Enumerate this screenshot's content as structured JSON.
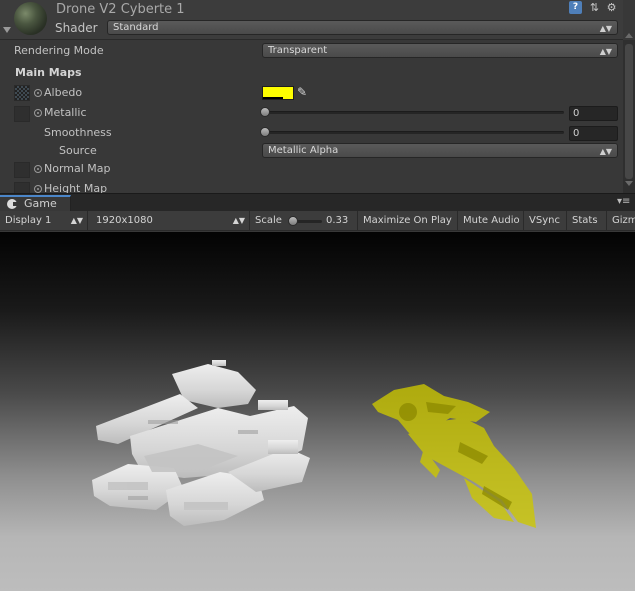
{
  "inspector": {
    "material_name": "Drone V2 Cyberte 1",
    "shader_label": "Shader",
    "shader_value": "Standard",
    "rendering_mode_label": "Rendering Mode",
    "rendering_mode_value": "Transparent",
    "main_maps_label": "Main Maps",
    "albedo_label": "Albedo",
    "albedo_color": "#fdfd00",
    "metallic_label": "Metallic",
    "metallic_value": "0",
    "smoothness_label": "Smoothness",
    "smoothness_value": "0",
    "source_label": "Source",
    "source_value": "Metallic Alpha",
    "normal_map_label": "Normal Map",
    "height_map_label": "Height Map",
    "icons": [
      "help-icon",
      "preset-icon",
      "gear-icon",
      "eyedropper-icon"
    ]
  },
  "game": {
    "tab_label": "Game",
    "display": "Display 1",
    "resolution": "1920x1080",
    "scale_label": "Scale",
    "scale_value": "0.33",
    "maximize_on_play": "Maximize On Play",
    "mute_audio": "Mute Audio",
    "vsync": "VSync",
    "stats": "Stats",
    "gizmos": "Gizmos"
  },
  "colors": {
    "accent": "#4b86c9",
    "drone_tint": "#cdc800"
  }
}
